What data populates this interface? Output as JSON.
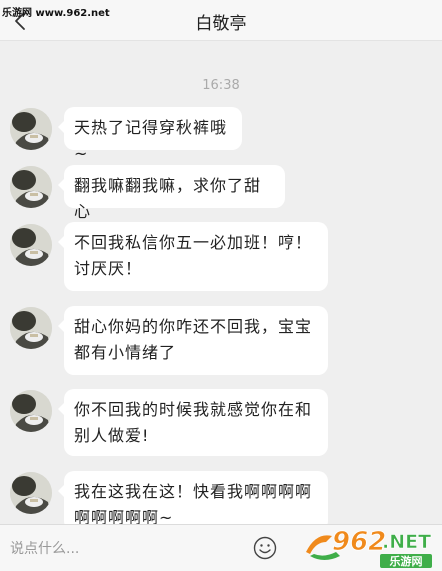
{
  "watermark": {
    "top_text": "乐游网 www.962.net"
  },
  "header": {
    "title": "白敬亭"
  },
  "chat": {
    "timestamp": "16:38",
    "messages": [
      {
        "text": "天热了记得穿秋裤哦~"
      },
      {
        "text": "翻我嘛翻我嘛，求你了甜心"
      },
      {
        "text": "不回我私信你五一必加班！哼！讨厌厌！"
      },
      {
        "text": "甜心你妈的你咋还不回我，宝宝都有小情绪了"
      },
      {
        "text": "你不回我的时候我就感觉你在和别人做爱!"
      },
      {
        "text": "我在这我在这！快看我啊啊啊啊啊啊啊啊啊~"
      }
    ]
  },
  "input": {
    "placeholder": "说点什么..."
  },
  "logo": {
    "number_text": "962",
    "suffix_text": ".NET",
    "sub_text": "乐游网"
  },
  "colors": {
    "background": "#efefef",
    "bubble": "#ffffff",
    "logo_orange": "#f08a1c",
    "logo_green": "#3fae49"
  },
  "icons": {
    "back": "chevron-left-icon",
    "emoji": "smiley-icon",
    "avatar": "user-avatar-photo"
  }
}
